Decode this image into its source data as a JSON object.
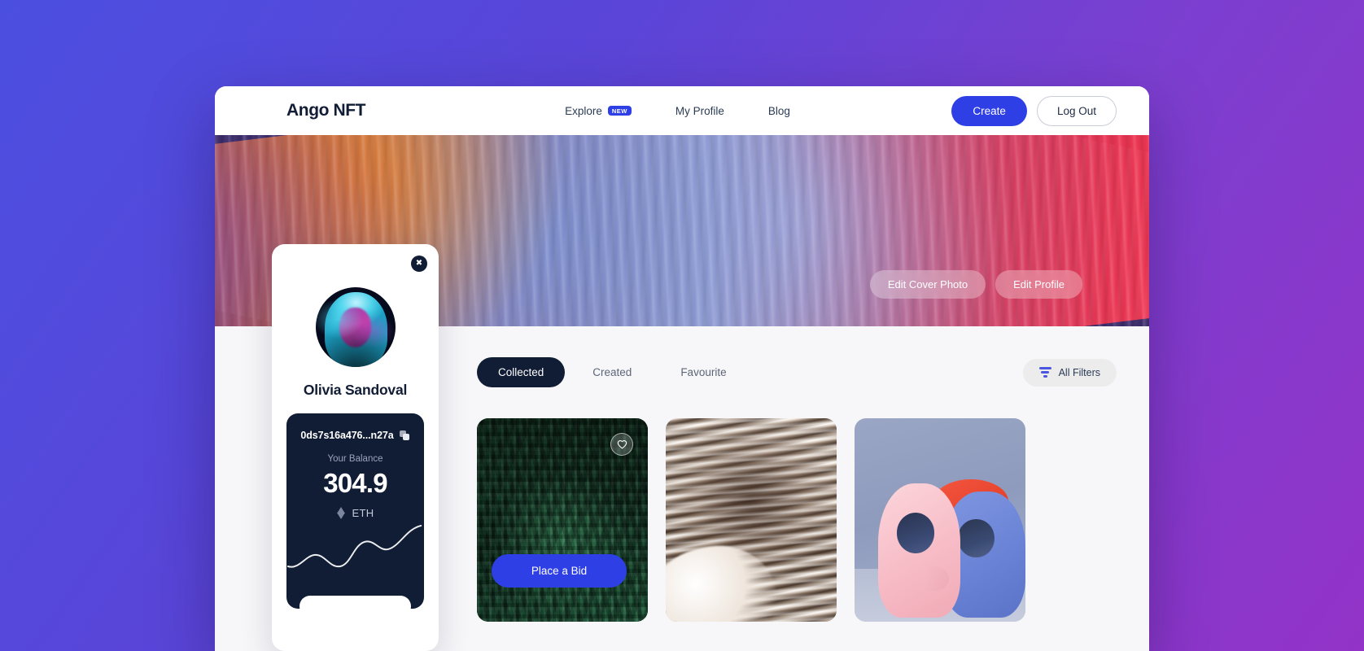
{
  "header": {
    "logo": "Ango NFT",
    "nav": [
      {
        "label": "Explore",
        "badge": "NEW"
      },
      {
        "label": "My Profile",
        "badge": ""
      },
      {
        "label": "Blog",
        "badge": ""
      }
    ],
    "create_label": "Create",
    "logout_label": "Log Out"
  },
  "cover": {
    "edit_cover_label": "Edit Cover Photo",
    "edit_profile_label": "Edit Profile"
  },
  "profile": {
    "close_icon": "close-icon",
    "avatar_icon": "avatar-portrait",
    "name": "Olivia Sandoval",
    "wallet_address": "0ds7s16a476...n27a",
    "copy_icon": "copy-icon",
    "balance_label": "Your Balance",
    "balance_value": "304.9",
    "currency": "ETH",
    "currency_icon": "ethereum-icon"
  },
  "tabs": [
    {
      "label": "Collected",
      "active": true
    },
    {
      "label": "Created",
      "active": false
    },
    {
      "label": "Favourite",
      "active": false
    }
  ],
  "filter": {
    "label": "All Filters",
    "icon": "filter-icon"
  },
  "nft_cards": [
    {
      "art": "green-voxel-terrain",
      "favourite_icon": "heart-icon",
      "bid_label": "Place a Bid"
    },
    {
      "art": "beige-draped-folds",
      "favourite_icon": "",
      "bid_label": ""
    },
    {
      "art": "pastel-3d-faces",
      "favourite_icon": "",
      "bid_label": ""
    }
  ],
  "colors": {
    "page_gradient_start": "#4b4fe0",
    "page_gradient_end": "#9333c8",
    "accent_blue": "#2e3fe5",
    "dark_navy": "#111c35",
    "surface": "#f7f7f9"
  }
}
